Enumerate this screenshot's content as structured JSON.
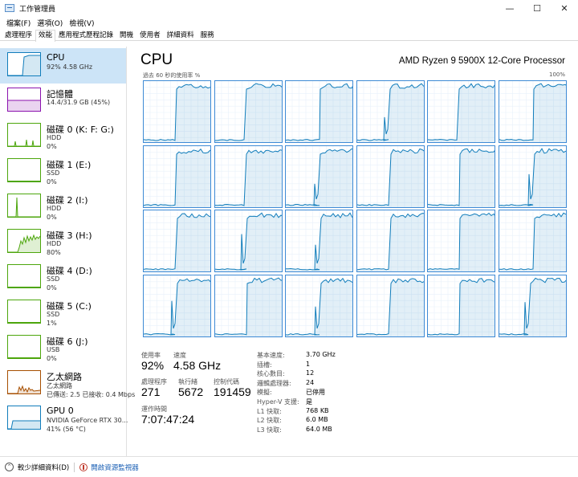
{
  "window": {
    "title": "工作管理員",
    "controls": [
      "—",
      "☐",
      "✕"
    ]
  },
  "menu": [
    "檔案(F)",
    "選項(O)",
    "檢視(V)"
  ],
  "tabs": [
    {
      "label": "處理程序",
      "active": false
    },
    {
      "label": "效能",
      "active": true
    },
    {
      "label": "應用程式歷程記錄",
      "active": false
    },
    {
      "label": "開機",
      "active": false
    },
    {
      "label": "使用者",
      "active": false
    },
    {
      "label": "詳細資料",
      "active": false
    },
    {
      "label": "服務",
      "active": false
    }
  ],
  "sidebar": {
    "items": [
      {
        "title": "CPU",
        "line1": "92% 4.58 GHz",
        "line2": "",
        "line3": "",
        "color": "#117dbb",
        "selected": true,
        "graph_type": "cpu"
      },
      {
        "title": "記憶體",
        "line1": "14.4/31.9 GB (45%)",
        "line2": "",
        "line3": "",
        "color": "#8b12ae",
        "selected": false,
        "graph_type": "mem"
      },
      {
        "title": "磁碟 0 (K: F: G:)",
        "line1": "HDD",
        "line2": "0%",
        "line3": "",
        "color": "#4da60c",
        "selected": false,
        "graph_type": "spikes"
      },
      {
        "title": "磁碟 1 (E:)",
        "line1": "SSD",
        "line2": "0%",
        "line3": "",
        "color": "#4da60c",
        "selected": false,
        "graph_type": "flat"
      },
      {
        "title": "磁碟 2 (I:)",
        "line1": "HDD",
        "line2": "0%",
        "line3": "",
        "color": "#4da60c",
        "selected": false,
        "graph_type": "spike1"
      },
      {
        "title": "磁碟 3 (H:)",
        "line1": "HDD",
        "line2": "80%",
        "line3": "",
        "color": "#4da60c",
        "selected": false,
        "graph_type": "busy"
      },
      {
        "title": "磁碟 4 (D:)",
        "line1": "SSD",
        "line2": "0%",
        "line3": "",
        "color": "#4da60c",
        "selected": false,
        "graph_type": "flat"
      },
      {
        "title": "磁碟 5 (C:)",
        "line1": "SSD",
        "line2": "1%",
        "line3": "",
        "color": "#4da60c",
        "selected": false,
        "graph_type": "flat"
      },
      {
        "title": "磁碟 6 (J:)",
        "line1": "USB",
        "line2": "0%",
        "line3": "",
        "color": "#4da60c",
        "selected": false,
        "graph_type": "flat"
      },
      {
        "title": "乙太網路",
        "line1": "乙太網路",
        "line2": "已傳送: 2.5 已接收: 0.4 Mbps",
        "line3": "",
        "color": "#a74f01",
        "selected": false,
        "graph_type": "net"
      },
      {
        "title": "GPU 0",
        "line1": "NVIDIA GeForce RTX 30...",
        "line2": "41% (56 °C)",
        "line3": "",
        "color": "#117dbb",
        "selected": false,
        "graph_type": "gpu"
      }
    ]
  },
  "main": {
    "title": "CPU",
    "model": "AMD Ryzen 9 5900X 12-Core Processor",
    "graph_caption": "過去 60 秒的使用率 %",
    "graph_max": "100%",
    "core_count_graphs": 24,
    "stats": {
      "usage_label": "使用率",
      "usage_value": "92%",
      "speed_label": "速度",
      "speed_value": "4.58 GHz",
      "processes_label": "處理程序",
      "processes_value": "271",
      "threads_label": "執行緒",
      "threads_value": "5672",
      "handles_label": "控制代碼",
      "handles_value": "191459",
      "uptime_label": "運作時間",
      "uptime_value": "7:07:47:24"
    },
    "specs": [
      {
        "label": "基本速度:",
        "value": "3.70 GHz"
      },
      {
        "label": "插槽:",
        "value": "1"
      },
      {
        "label": "核心數目:",
        "value": "12"
      },
      {
        "label": "邏輯處理器:",
        "value": "24"
      },
      {
        "label": "模擬:",
        "value": "已停用"
      },
      {
        "label": "Hyper-V 支援:",
        "value": "是"
      },
      {
        "label": "L1 快取:",
        "value": "768 KB"
      },
      {
        "label": "L2 快取:",
        "value": "6.0 MB"
      },
      {
        "label": "L3 快取:",
        "value": "64.0 MB"
      }
    ]
  },
  "footer": {
    "fewer_details": "較少詳細資料(D)",
    "resource_monitor": "開啟資源監視器"
  }
}
